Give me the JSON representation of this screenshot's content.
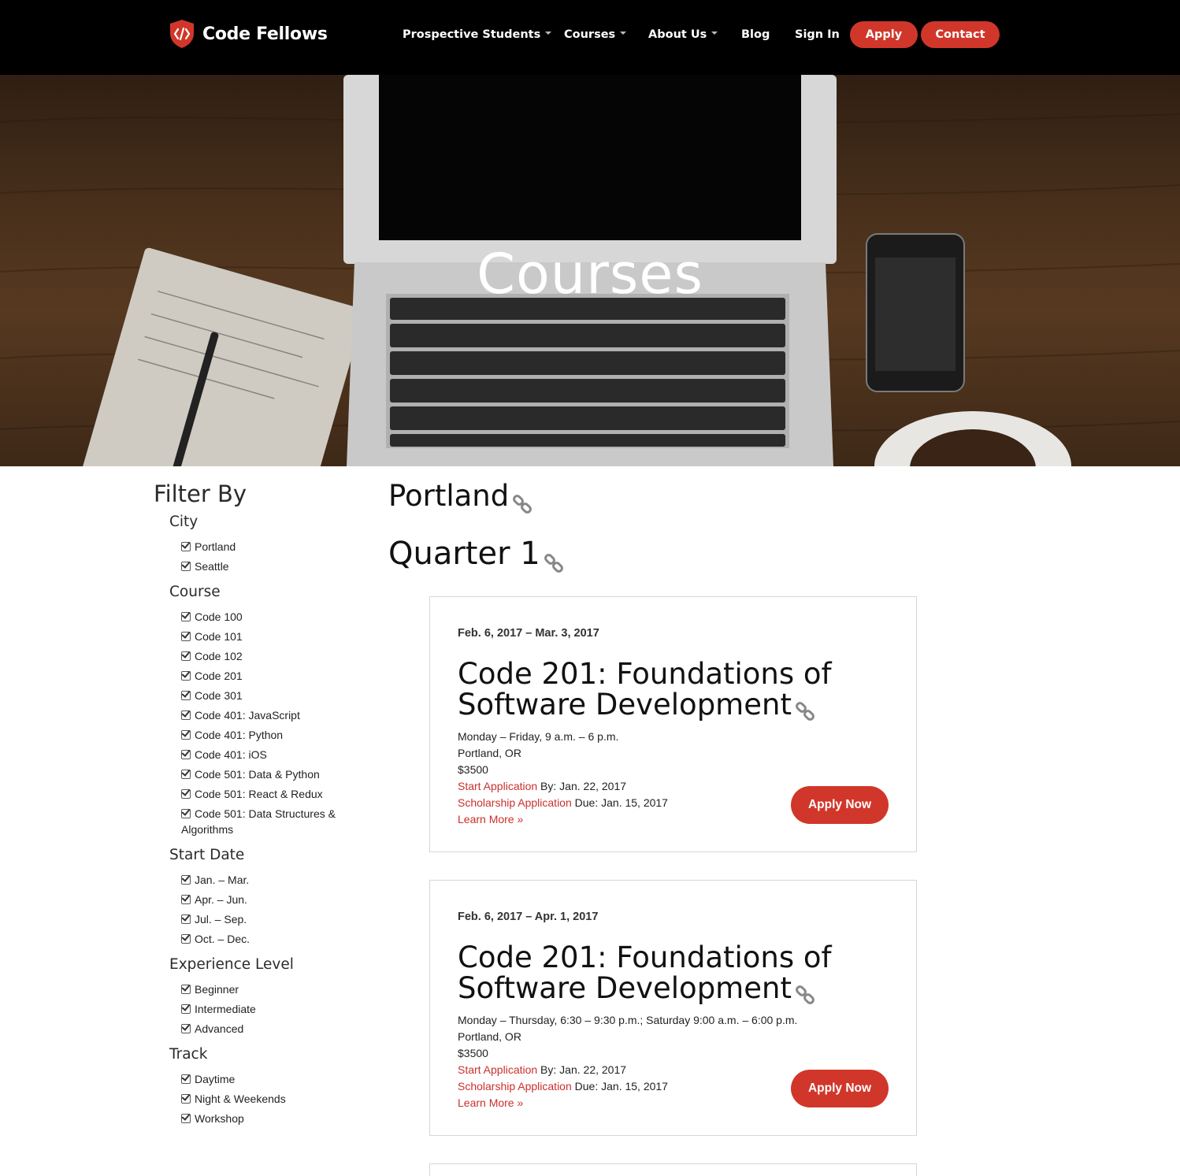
{
  "brand": {
    "name": "Code Fellows",
    "accent": "#d0372a"
  },
  "nav": {
    "items": [
      {
        "label": "Prospective Students",
        "dropdown": true
      },
      {
        "label": "Courses",
        "dropdown": true
      },
      {
        "label": "About Us",
        "dropdown": true
      },
      {
        "label": "Blog",
        "dropdown": false
      },
      {
        "label": "Sign In",
        "dropdown": false
      }
    ],
    "apply_label": "Apply",
    "contact_label": "Contact"
  },
  "hero": {
    "title": "Courses"
  },
  "filters": {
    "title": "Filter By",
    "groups": [
      {
        "title": "City",
        "options": [
          "Portland",
          "Seattle"
        ]
      },
      {
        "title": "Course",
        "options": [
          "Code 100",
          "Code 101",
          "Code 102",
          "Code 201",
          "Code 301",
          "Code 401: JavaScript",
          "Code 401: Python",
          "Code 401: iOS",
          "Code 501: Data & Python",
          "Code 501: React & Redux",
          "Code 501: Data Structures & Algorithms"
        ]
      },
      {
        "title": "Start Date",
        "options": [
          "Jan. – Mar.",
          "Apr. – Jun.",
          "Jul. – Sep.",
          "Oct. – Dec."
        ]
      },
      {
        "title": "Experience Level",
        "options": [
          "Beginner",
          "Intermediate",
          "Advanced"
        ]
      },
      {
        "title": "Track",
        "options": [
          "Daytime",
          "Night & Weekends",
          "Workshop"
        ]
      }
    ]
  },
  "main": {
    "city_heading": "Portland",
    "quarter_heading": "Quarter 1",
    "courses": [
      {
        "date": "Feb. 6, 2017 – Mar. 3, 2017",
        "title_line1": "Code 201: Foundations of",
        "title_line2": "Software Development",
        "schedule": "Monday – Friday, 9 a.m. – 6 p.m.",
        "location": "Portland, OR",
        "price": "$3500",
        "start_app_label": "Start Application",
        "start_app_by": " By: Jan. 22, 2017",
        "scholarship_label": "Scholarship Application",
        "scholarship_due": " Due: Jan. 15, 2017",
        "learn_more": "Learn More »",
        "apply_label": "Apply Now"
      },
      {
        "date": "Feb. 6, 2017 – Apr. 1, 2017",
        "title_line1": "Code 201: Foundations of",
        "title_line2": "Software Development",
        "schedule": "Monday – Thursday, 6:30 – 9:30 p.m.; Saturday 9:00 a.m. – 6:00 p.m.",
        "location": "Portland, OR",
        "price": "$3500",
        "start_app_label": "Start Application",
        "start_app_by": " By: Jan. 22, 2017",
        "scholarship_label": "Scholarship Application",
        "scholarship_due": " Due: Jan. 15, 2017",
        "learn_more": "Learn More »",
        "apply_label": "Apply Now"
      }
    ]
  }
}
